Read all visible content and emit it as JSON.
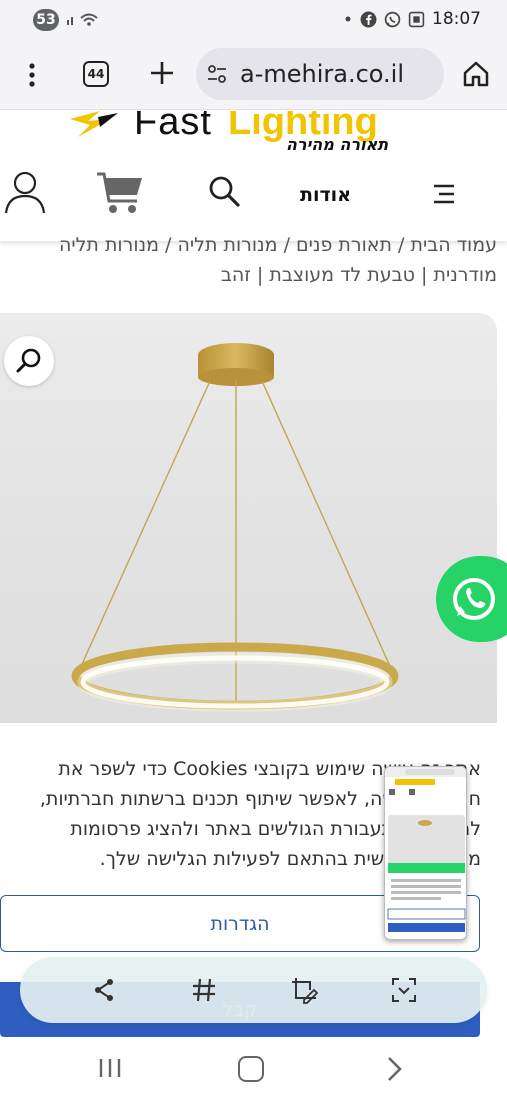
{
  "status_bar": {
    "notification_count": "53",
    "time": "18:07",
    "icons": [
      "signal-icon",
      "wifi-icon",
      "dot-icon",
      "facebook-icon",
      "whatsapp-icon",
      "screenshot-icon"
    ]
  },
  "browser": {
    "tab_count": "44",
    "url": "a-mehira.co.il",
    "icons": [
      "menu-dots-icon",
      "tabs-icon",
      "new-tab-plus-icon",
      "site-settings-icon",
      "home-icon"
    ]
  },
  "site": {
    "logo_fast": "Fast",
    "logo_lighting": "Lighting",
    "logo_tagline": "תאורה מהירה",
    "nav_about": "אודות",
    "icons": [
      "user-icon",
      "cart-icon",
      "search-icon",
      "hamburger-menu-icon"
    ]
  },
  "breadcrumb": {
    "line1": "עמוד הבית / תאורת פנים / מנורות תליה / מנורות תליה",
    "line2": "מודרנית | טבעת לד מעוצבת | זהב"
  },
  "product": {
    "icons": [
      "zoom-icon",
      "whatsapp-icon"
    ]
  },
  "cookie_banner": {
    "text": "אתר זה עושה שימוש בקובצי Cookies כדי לשפר את חוויית הגלישה, לאפשר שיתוף תכנים ברשתות חברתיות, למדוד את תעבורת הגולשים באתר ולהציג פרסומות מותאמות אישית בהתאם לפעילות הגלישה שלך.",
    "settings_label": "הגדרות",
    "accept_label": "קבל"
  },
  "screenshot_toolbar": {
    "icons": [
      "share-icon",
      "hashtag-icon",
      "edit-crop-icon",
      "scroll-capture-icon"
    ]
  },
  "android_nav": {
    "icons": [
      "recents-icon",
      "home-button-icon",
      "back-icon"
    ]
  },
  "colors": {
    "brand_yellow": "#f2c400",
    "whatsapp_green": "#25d366",
    "button_blue": "#2f5aa8",
    "ring_gold": "#c9a94a"
  }
}
